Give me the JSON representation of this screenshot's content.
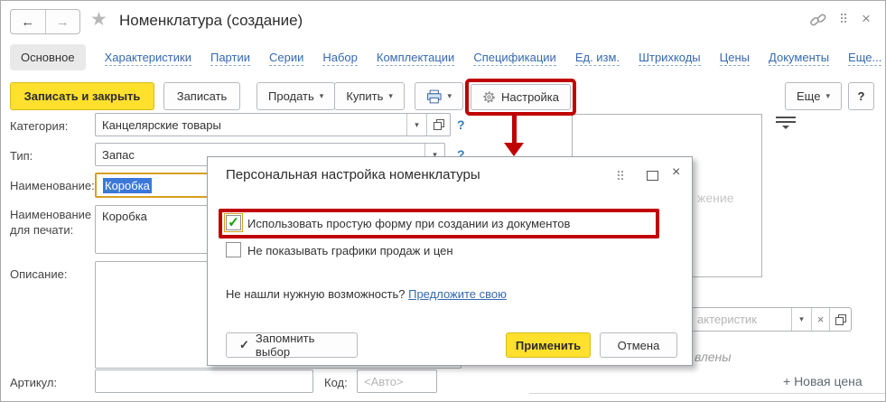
{
  "window": {
    "title": "Номенклатура (создание)"
  },
  "icons": {
    "back": "←",
    "forward": "→",
    "favorite_star": "★",
    "dropdown": "▾",
    "close": "×",
    "checkmark": "✓",
    "clear": "×"
  },
  "tabs": {
    "items": [
      "Основное",
      "Характеристики",
      "Партии",
      "Серии",
      "Набор",
      "Комплектации",
      "Спецификации",
      "Ед. изм.",
      "Штрихкоды",
      "Цены",
      "Документы",
      "Еще..."
    ]
  },
  "toolbar": {
    "save_and_close": "Записать и закрыть",
    "save": "Записать",
    "sell": "Продать",
    "buy": "Купить",
    "settings": "Настройка",
    "more": "Еще",
    "help": "?"
  },
  "form": {
    "help_mark": "?",
    "category": {
      "label": "Категория:",
      "value": "Канцелярские товары"
    },
    "type": {
      "label": "Тип:",
      "value": "Запас"
    },
    "name": {
      "label": "Наименование:",
      "value": "Коробка",
      "selected": true
    },
    "print_name": {
      "label_line1": "Наименование",
      "label_line2": "для печати:",
      "value": "Коробка"
    },
    "description": {
      "label": "Описание:",
      "value": ""
    },
    "sku": {
      "label": "Артикул:",
      "value": ""
    },
    "code": {
      "label": "Код:",
      "placeholder": "<Авто>"
    }
  },
  "right_panel": {
    "image_placeholder_fragment": "жение",
    "characteristics_placeholder_fragment": "актеристик",
    "prices_status_fragment": "влены",
    "new_price_link": "+ Новая цена"
  },
  "dialog": {
    "title": "Персональная настройка номенклатуры",
    "checkbox_simple_form": {
      "label": "Использовать простую форму при создании из документов",
      "checked": true
    },
    "checkbox_no_charts": {
      "label": "Не показывать графики продаж и цен",
      "checked": false
    },
    "question_text": "Не нашли нужную возможность?",
    "suggest_link": "Предложите свою",
    "remember_button": "Запомнить выбор",
    "apply_button": "Применить",
    "cancel_button": "Отмена"
  },
  "colors": {
    "accent_yellow": "#ffe02d",
    "highlight_red": "#c00000",
    "link_blue": "#3569b0",
    "selection_blue": "#3c78d8",
    "focus_orange": "#d7a021"
  }
}
